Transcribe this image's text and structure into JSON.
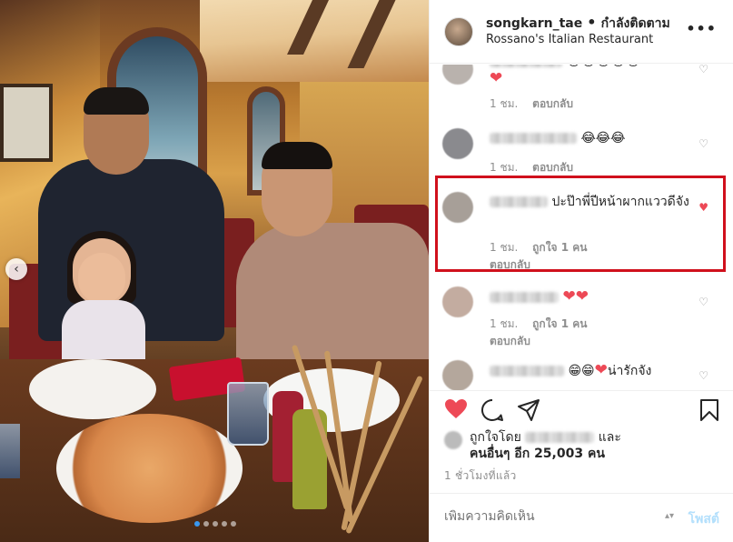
{
  "header": {
    "username": "songkarn_tae",
    "separator": "•",
    "follow_status": "กำลังติดตาม",
    "location": "Rossano's Italian Restaurant",
    "more_icon": "more-horizontal-icon"
  },
  "comments": [
    {
      "text_emoji": "😂😂😂😂😂",
      "text_heart": "❤",
      "time": "1 ชม.",
      "likes": "",
      "reply": "ตอบกลับ"
    },
    {
      "text_emoji": "😂😂😂",
      "time": "1 ชม.",
      "likes": "",
      "reply": "ตอบกลับ"
    },
    {
      "text": "ปะป๊าพี่ปีหน้าผากแววดีจัง",
      "time": "1 ชม.",
      "likes": "ถูกใจ 1 คน",
      "reply": "ตอบกลับ",
      "liked": true
    },
    {
      "text_emoji": "❤❤",
      "time": "1 ชม.",
      "likes": "ถูกใจ 1 คน",
      "reply": "ตอบกลับ"
    },
    {
      "text_emoji": "😁😁",
      "text_heart": "❤",
      "text": "น่ารักจัง"
    }
  ],
  "actions": {
    "like_icon": "heart-filled-icon",
    "comment_icon": "comment-icon",
    "share_icon": "share-icon",
    "save_icon": "bookmark-icon"
  },
  "likes": {
    "prefix": "ถูกใจโดย",
    "and": "และ",
    "others": "คนอื่นๆ อีก 25,003 คน"
  },
  "time_ago": "1 ชั่วโมงที่แล้ว",
  "add_comment": {
    "placeholder": "เพิ่มความคิดเห็น",
    "post_label": "โพสต์"
  },
  "carousel": {
    "slides": 5,
    "active_index": 0
  },
  "colors": {
    "like_red": "#ed4956",
    "highlight_red": "#d0101c",
    "link_blue": "#3897f0"
  }
}
